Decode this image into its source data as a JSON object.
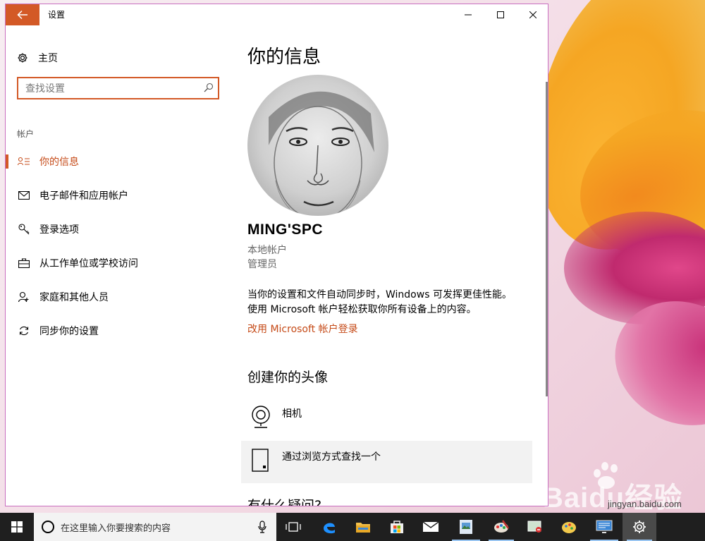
{
  "window": {
    "title": "设置",
    "back_icon": "arrow-left-icon",
    "accent_color": "#d35926"
  },
  "sidebar": {
    "home_label": "主页",
    "search_placeholder": "查找设置",
    "section_label": "帐户",
    "items": [
      {
        "label": "你的信息",
        "icon": "person-list-icon",
        "active": true
      },
      {
        "label": "电子邮件和应用帐户",
        "icon": "mail-icon",
        "active": false
      },
      {
        "label": "登录选项",
        "icon": "key-icon",
        "active": false
      },
      {
        "label": "从工作单位或学校访问",
        "icon": "briefcase-icon",
        "active": false
      },
      {
        "label": "家庭和其他人员",
        "icon": "person-add-icon",
        "active": false
      },
      {
        "label": "同步你的设置",
        "icon": "sync-icon",
        "active": false
      }
    ]
  },
  "content": {
    "title": "你的信息",
    "user_name": "MING'SPC",
    "account_type": "本地帐户",
    "role": "管理员",
    "description_line1": "当你的设置和文件自动同步时，Windows 可发挥更佳性能。",
    "description_line2": "使用 Microsoft 帐户轻松获取你所有设备上的内容。",
    "ms_link": "改用 Microsoft 帐户登录",
    "create_avatar_heading": "创建你的头像",
    "options": [
      {
        "label": "相机",
        "icon": "webcam-icon"
      },
      {
        "label": "通过浏览方式查找一个",
        "icon": "browse-file-icon"
      }
    ],
    "questions_heading": "有什么疑问?"
  },
  "taskbar": {
    "search_placeholder": "在这里输入你要搜索的内容"
  },
  "watermark": {
    "brand": "Baidu经验",
    "site": "jingyan.baidu.com"
  }
}
